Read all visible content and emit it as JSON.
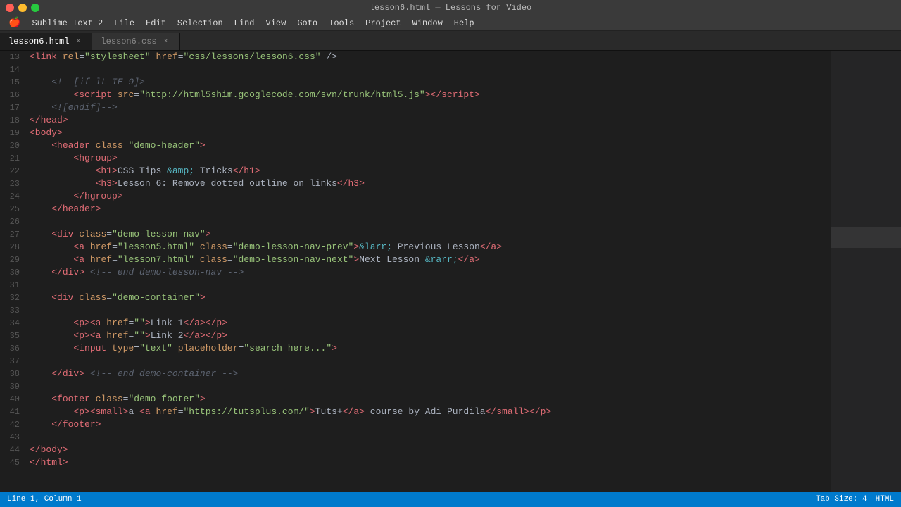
{
  "titlebar": {
    "title": "lesson6.html — Lessons for Video"
  },
  "menubar": {
    "apple": "🍎",
    "items": [
      "Sublime Text 2",
      "File",
      "Edit",
      "Selection",
      "Find",
      "View",
      "Goto",
      "Tools",
      "Project",
      "Window",
      "Help"
    ]
  },
  "tabs": [
    {
      "label": "lesson6.html",
      "active": true
    },
    {
      "label": "lesson6.css",
      "active": false
    }
  ],
  "lines": [
    {
      "num": 13,
      "html": "<span class='tag'>&lt;link</span> <span class='attr'>rel</span><span class='punct'>=</span><span class='val'>\"stylesheet\"</span> <span class='attr'>href</span><span class='punct'>=</span><span class='val'>\"css/lessons/lesson6.css\"</span> <span class='punct'>/&gt;</span>"
    },
    {
      "num": 14,
      "html": ""
    },
    {
      "num": 15,
      "html": "<span class='plain'>    </span><span class='comment'>&lt;!--[if lt IE 9]&gt;</span>"
    },
    {
      "num": 16,
      "html": "<span class='plain'>        </span><span class='tag'>&lt;script</span> <span class='attr'>src</span><span class='punct'>=</span><span class='val'>\"http://html5shim.googlecode.com/svn/trunk/html5.js\"</span><span class='tag'>&gt;&lt;/script&gt;</span>"
    },
    {
      "num": 17,
      "html": "<span class='plain'>    </span><span class='comment'>&lt;![endif]--&gt;</span>"
    },
    {
      "num": 18,
      "html": "<span class='tag'>&lt;/head&gt;</span>"
    },
    {
      "num": 19,
      "html": "<span class='tag'>&lt;body&gt;</span>"
    },
    {
      "num": 20,
      "html": "<span class='plain'>    </span><span class='tag'>&lt;header</span> <span class='attr'>class</span><span class='punct'>=</span><span class='val'>\"demo-header\"</span><span class='tag'>&gt;</span>"
    },
    {
      "num": 21,
      "html": "<span class='plain'>        </span><span class='tag'>&lt;hgroup&gt;</span>"
    },
    {
      "num": 22,
      "html": "<span class='plain'>            </span><span class='tag'>&lt;h1&gt;</span><span class='plain'>CSS Tips </span><span class='entity'>&amp;amp;</span><span class='plain'> Tricks</span><span class='tag'>&lt;/h1&gt;</span>"
    },
    {
      "num": 23,
      "html": "<span class='plain'>            </span><span class='tag'>&lt;h3&gt;</span><span class='plain'>Lesson 6: Remove dotted outline on links</span><span class='tag'>&lt;/h3&gt;</span>"
    },
    {
      "num": 24,
      "html": "<span class='plain'>        </span><span class='tag'>&lt;/hgroup&gt;</span>"
    },
    {
      "num": 25,
      "html": "<span class='plain'>    </span><span class='tag'>&lt;/header&gt;</span>"
    },
    {
      "num": 26,
      "html": ""
    },
    {
      "num": 27,
      "html": "<span class='plain'>    </span><span class='tag'>&lt;div</span> <span class='attr'>class</span><span class='punct'>=</span><span class='val'>\"demo-lesson-nav\"</span><span class='tag'>&gt;</span>"
    },
    {
      "num": 28,
      "html": "<span class='plain'>        </span><span class='tag'>&lt;a</span> <span class='attr'>href</span><span class='punct'>=</span><span class='val'>\"lesson5.html\"</span> <span class='attr'>class</span><span class='punct'>=</span><span class='val'>\"demo-lesson-nav-prev\"</span><span class='tag'>&gt;</span><span class='entity'>&amp;larr;</span><span class='plain'> Previous Lesson</span><span class='tag'>&lt;/a&gt;</span>"
    },
    {
      "num": 29,
      "html": "<span class='plain'>        </span><span class='tag'>&lt;a</span> <span class='attr'>href</span><span class='punct'>=</span><span class='val'>\"lesson7.html\"</span> <span class='attr'>class</span><span class='punct'>=</span><span class='val'>\"demo-lesson-nav-next\"</span><span class='tag'>&gt;</span><span class='plain'>Next Lesson </span><span class='entity'>&amp;rarr;</span><span class='tag'>&lt;/a&gt;</span>"
    },
    {
      "num": 30,
      "html": "<span class='plain'>    </span><span class='tag'>&lt;/div&gt;</span> <span class='comment'>&lt;!-- end demo-lesson-nav --&gt;</span>"
    },
    {
      "num": 31,
      "html": ""
    },
    {
      "num": 32,
      "html": "<span class='plain'>    </span><span class='tag'>&lt;div</span> <span class='attr'>class</span><span class='punct'>=</span><span class='val'>\"demo-container\"</span><span class='tag'>&gt;</span>"
    },
    {
      "num": 33,
      "html": ""
    },
    {
      "num": 34,
      "html": "<span class='plain'>        </span><span class='tag'>&lt;p&gt;&lt;a</span> <span class='attr'>href</span><span class='punct'>=</span><span class='val'>\"\"</span><span class='tag'>&gt;</span><span class='plain'>Link 1</span><span class='tag'>&lt;/a&gt;&lt;/p&gt;</span>"
    },
    {
      "num": 35,
      "html": "<span class='plain'>        </span><span class='tag'>&lt;p&gt;&lt;a</span> <span class='attr'>href</span><span class='punct'>=</span><span class='val'>\"\"</span><span class='tag'>&gt;</span><span class='plain'>Link 2</span><span class='tag'>&lt;/a&gt;&lt;/p&gt;</span>"
    },
    {
      "num": 36,
      "html": "<span class='plain'>        </span><span class='tag'>&lt;input</span> <span class='attr'>type</span><span class='punct'>=</span><span class='val'>\"text\"</span> <span class='attr'>placeholder</span><span class='punct'>=</span><span class='val'>\"search here...\"</span><span class='tag'>&gt;</span>"
    },
    {
      "num": 37,
      "html": ""
    },
    {
      "num": 38,
      "html": "<span class='plain'>    </span><span class='tag'>&lt;/div&gt;</span> <span class='comment'>&lt;!-- end demo-container --&gt;</span>"
    },
    {
      "num": 39,
      "html": ""
    },
    {
      "num": 40,
      "html": "<span class='plain'>    </span><span class='tag'>&lt;footer</span> <span class='attr'>class</span><span class='punct'>=</span><span class='val'>\"demo-footer\"</span><span class='tag'>&gt;</span>"
    },
    {
      "num": 41,
      "html": "<span class='plain'>        </span><span class='tag'>&lt;p&gt;&lt;small&gt;</span><span class='plain'>a </span><span class='tag'>&lt;a</span> <span class='attr'>href</span><span class='punct'>=</span><span class='val'>\"https://tutsplus.com/\"</span><span class='tag'>&gt;</span><span class='plain'>Tuts+</span><span class='tag'>&lt;/a&gt;</span><span class='plain'> course by Adi Purdila</span><span class='tag'>&lt;/small&gt;&lt;/p&gt;</span>"
    },
    {
      "num": 42,
      "html": "<span class='plain'>    </span><span class='tag'>&lt;/footer&gt;</span>"
    },
    {
      "num": 43,
      "html": ""
    },
    {
      "num": 44,
      "html": "<span class='tag'>&lt;/body&gt;</span>"
    },
    {
      "num": 45,
      "html": "<span class='tag'>&lt;/html&gt;</span>"
    }
  ],
  "statusbar": {
    "left": "Line 1, Column 1",
    "right": "Tab Size: 4",
    "lang": "HTML"
  }
}
